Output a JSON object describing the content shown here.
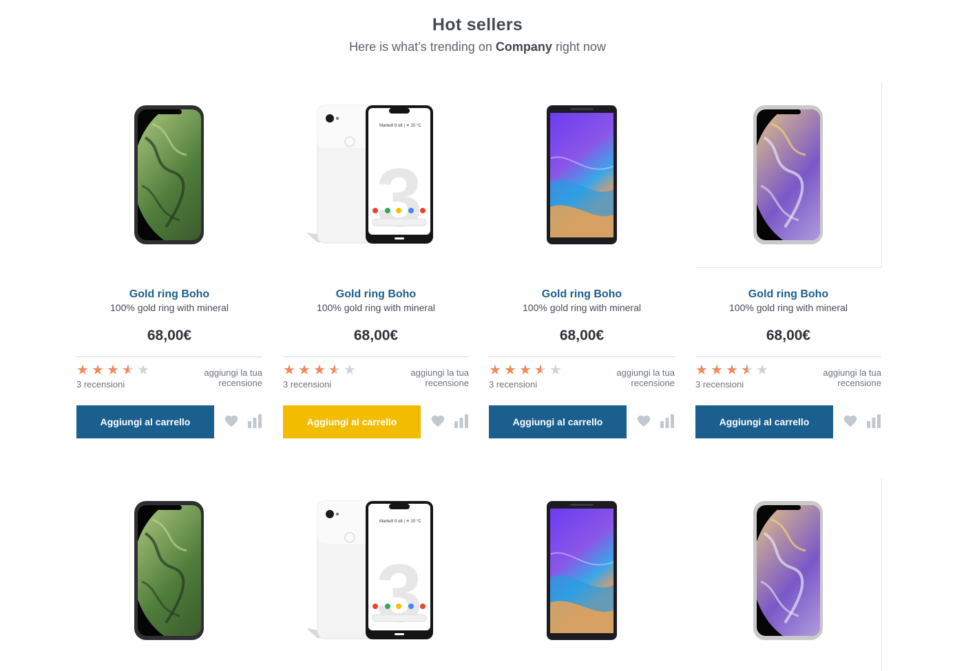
{
  "header": {
    "title": "Hot sellers",
    "subtitle_prefix": "Here is what’s trending on ",
    "subtitle_brand": "Company",
    "subtitle_suffix": " right now"
  },
  "colors": {
    "primary_button": "#1a5f8e",
    "accent_button": "#f2bd00",
    "star": "#ef8a5c",
    "product_name": "#1c5f8c"
  },
  "products": [
    {
      "name": "Gold ring Boho",
      "description": "100% gold ring with mineral",
      "price": "68,00€",
      "rating": 3.5,
      "reviews": "3 recensioni",
      "add_review": "aggiungi la tua recensione",
      "cart_label": "Aggiungi al carrello",
      "image": "iphone-xs-space-gray"
    },
    {
      "name": "Gold ring Boho",
      "description": "100% gold ring with mineral",
      "price": "68,00€",
      "rating": 3.5,
      "reviews": "3 recensioni",
      "add_review": "aggiungi la tua recensione",
      "cart_label": "Aggiungi al carrello",
      "image": "pixel-3-white",
      "screen_text": "Martedì 9 ott | ☀ 20 °C"
    },
    {
      "name": "Gold ring Boho",
      "description": "100% gold ring with mineral",
      "price": "68,00€",
      "rating": 3.5,
      "reviews": "3 recensioni",
      "add_review": "aggiungi la tua recensione",
      "cart_label": "Aggiungi al carrello",
      "image": "galaxy-a9"
    },
    {
      "name": "Gold ring Boho",
      "description": "100% gold ring with mineral",
      "price": "68,00€",
      "rating": 3.5,
      "reviews": "3 recensioni",
      "add_review": "aggiungi la tua recensione",
      "cart_label": "Aggiungi al carrello",
      "image": "iphone-xs-silver"
    }
  ],
  "row2_images": [
    {
      "image": "iphone-xs-space-gray"
    },
    {
      "image": "pixel-3-white",
      "screen_text": "Martedì 9 ott | ☀ 20 °C"
    },
    {
      "image": "galaxy-a9"
    },
    {
      "image": "iphone-xs-silver"
    }
  ],
  "icons": {
    "wishlist": "heart-icon",
    "compare": "bar-chart-icon"
  }
}
